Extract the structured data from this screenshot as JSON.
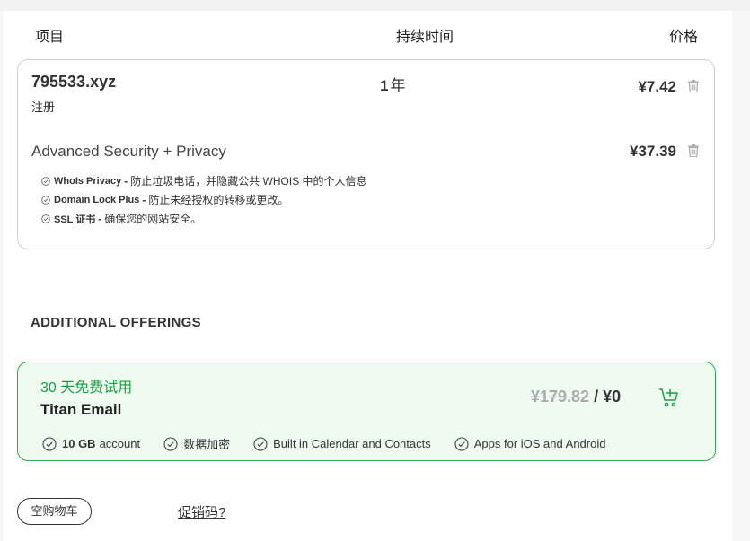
{
  "headers": {
    "item": "项目",
    "duration": "持续时间",
    "price": "价格"
  },
  "cart": {
    "domain": {
      "name": "795533.xyz",
      "action": "注册",
      "duration_num": "1",
      "duration_unit": "年",
      "price": "¥7.42"
    },
    "security": {
      "title": "Advanced Security + Privacy",
      "price": "¥37.39",
      "features": [
        {
          "name": "WhoIs Privacy",
          "desc": "防止垃圾电话，并隐藏公共 WHOIS 中的个人信息"
        },
        {
          "name": "Domain Lock Plus",
          "desc": "防止未经授权的转移或更改。"
        },
        {
          "name": "SSL 证书",
          "desc": "确保您的网站安全。"
        }
      ]
    }
  },
  "offerings": {
    "heading": "ADDITIONAL OFFERINGS",
    "titan": {
      "trial": "30 天免费试用",
      "name": "Titan Email",
      "old_price": "¥179.82",
      "separator": " / ",
      "new_price": "¥0",
      "features": [
        {
          "bold": "10 GB",
          "text": "account"
        },
        {
          "bold": "",
          "text": "数据加密"
        },
        {
          "bold": "",
          "text": "Built in Calendar and Contacts"
        },
        {
          "bold": "",
          "text": "Apps for iOS and Android"
        }
      ]
    }
  },
  "actions": {
    "empty_cart": "空购物车",
    "promo": "促销码?"
  },
  "icons": {
    "trash": "trash-icon",
    "check": "check-circle-icon",
    "cart_add": "cart-add-icon"
  },
  "colors": {
    "accent_green": "#1c9c43",
    "offer_bg": "#eefaf0",
    "offer_border": "#2fa84f"
  }
}
